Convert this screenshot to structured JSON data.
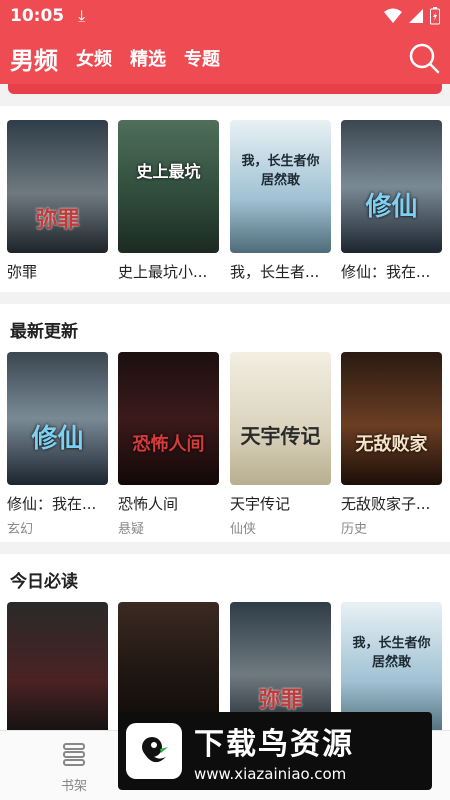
{
  "status": {
    "time": "10:05"
  },
  "header": {
    "tabs": [
      "男频",
      "女频",
      "精选",
      "专题"
    ]
  },
  "sections": [
    {
      "title": "",
      "books": [
        {
          "title": "弥罪",
          "cover_text": "弥罪"
        },
        {
          "title": "史上最坑小...",
          "cover_text": "史上最坑"
        },
        {
          "title": "我，长生者...",
          "cover_text": "我，长生者你居然敢"
        },
        {
          "title": "修仙：我在...",
          "cover_text": "修仙"
        }
      ]
    },
    {
      "title": "最新更新",
      "books": [
        {
          "title": "修仙：我在...",
          "category": "玄幻",
          "cover_text": "修仙"
        },
        {
          "title": "恐怖人间",
          "category": "悬疑",
          "cover_text": "恐怖人间"
        },
        {
          "title": "天宇传记",
          "category": "仙侠",
          "cover_text": "天宇传记"
        },
        {
          "title": "无敌败家子...",
          "category": "历史",
          "cover_text": "无敌败家"
        }
      ]
    },
    {
      "title": "今日必读",
      "books": [
        {
          "cover_text": ""
        },
        {
          "cover_text": ""
        },
        {
          "cover_text": "弥罪"
        },
        {
          "cover_text": "我，长生者你居然敢"
        }
      ]
    }
  ],
  "tabbar": {
    "bookshelf": "书架"
  },
  "watermark": {
    "main": "下载鸟资源",
    "url": "www.xiazainiao.com"
  }
}
